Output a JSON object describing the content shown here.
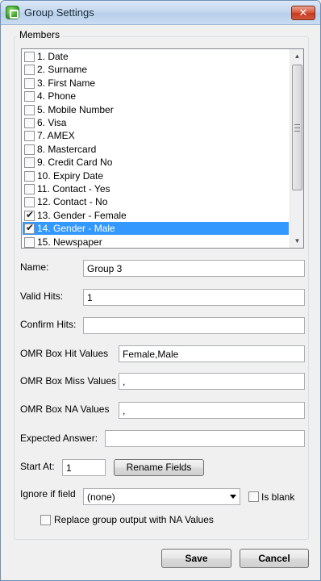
{
  "window": {
    "title": "Group Settings",
    "close_label": "✕"
  },
  "members": {
    "legend": "Members",
    "items": [
      {
        "label": "1. Date",
        "checked": false,
        "selected": false
      },
      {
        "label": "2. Surname",
        "checked": false,
        "selected": false
      },
      {
        "label": "3. First Name",
        "checked": false,
        "selected": false
      },
      {
        "label": "4. Phone",
        "checked": false,
        "selected": false
      },
      {
        "label": "5. Mobile Number",
        "checked": false,
        "selected": false
      },
      {
        "label": "6. Visa",
        "checked": false,
        "selected": false
      },
      {
        "label": "7. AMEX",
        "checked": false,
        "selected": false
      },
      {
        "label": "8. Mastercard",
        "checked": false,
        "selected": false
      },
      {
        "label": "9. Credit Card No",
        "checked": false,
        "selected": false
      },
      {
        "label": "10. Expiry Date",
        "checked": false,
        "selected": false
      },
      {
        "label": "11. Contact - Yes",
        "checked": false,
        "selected": false
      },
      {
        "label": "12. Contact - No",
        "checked": false,
        "selected": false
      },
      {
        "label": "13. Gender - Female",
        "checked": true,
        "selected": false
      },
      {
        "label": "14. Gender - Male",
        "checked": true,
        "selected": true
      },
      {
        "label": "15. Newspaper",
        "checked": false,
        "selected": false
      }
    ]
  },
  "fields": {
    "name": {
      "label": "Name:",
      "value": "Group 3"
    },
    "valid_hits": {
      "label": "Valid Hits:",
      "value": "1"
    },
    "confirm_hits": {
      "label": "Confirm Hits:",
      "value": ""
    },
    "omr_hit": {
      "label": "OMR Box Hit Values",
      "value": "Female,Male"
    },
    "omr_miss": {
      "label": "OMR Box Miss Values",
      "value": ","
    },
    "omr_na": {
      "label": "OMR Box NA Values",
      "value": ","
    },
    "expected": {
      "label": "Expected Answer:",
      "value": ""
    },
    "start_at": {
      "label": "Start At:",
      "value": "1"
    },
    "rename_button": "Rename Fields",
    "ignore": {
      "label": "Ignore if field",
      "selected": "(none)"
    },
    "is_blank": {
      "label": "Is blank",
      "checked": false
    },
    "replace_na": {
      "label": "Replace group output with NA Values",
      "checked": false
    }
  },
  "footer": {
    "save": "Save",
    "cancel": "Cancel"
  },
  "colors": {
    "selection": "#3399ff",
    "titlebar": "#c5d8ef"
  }
}
